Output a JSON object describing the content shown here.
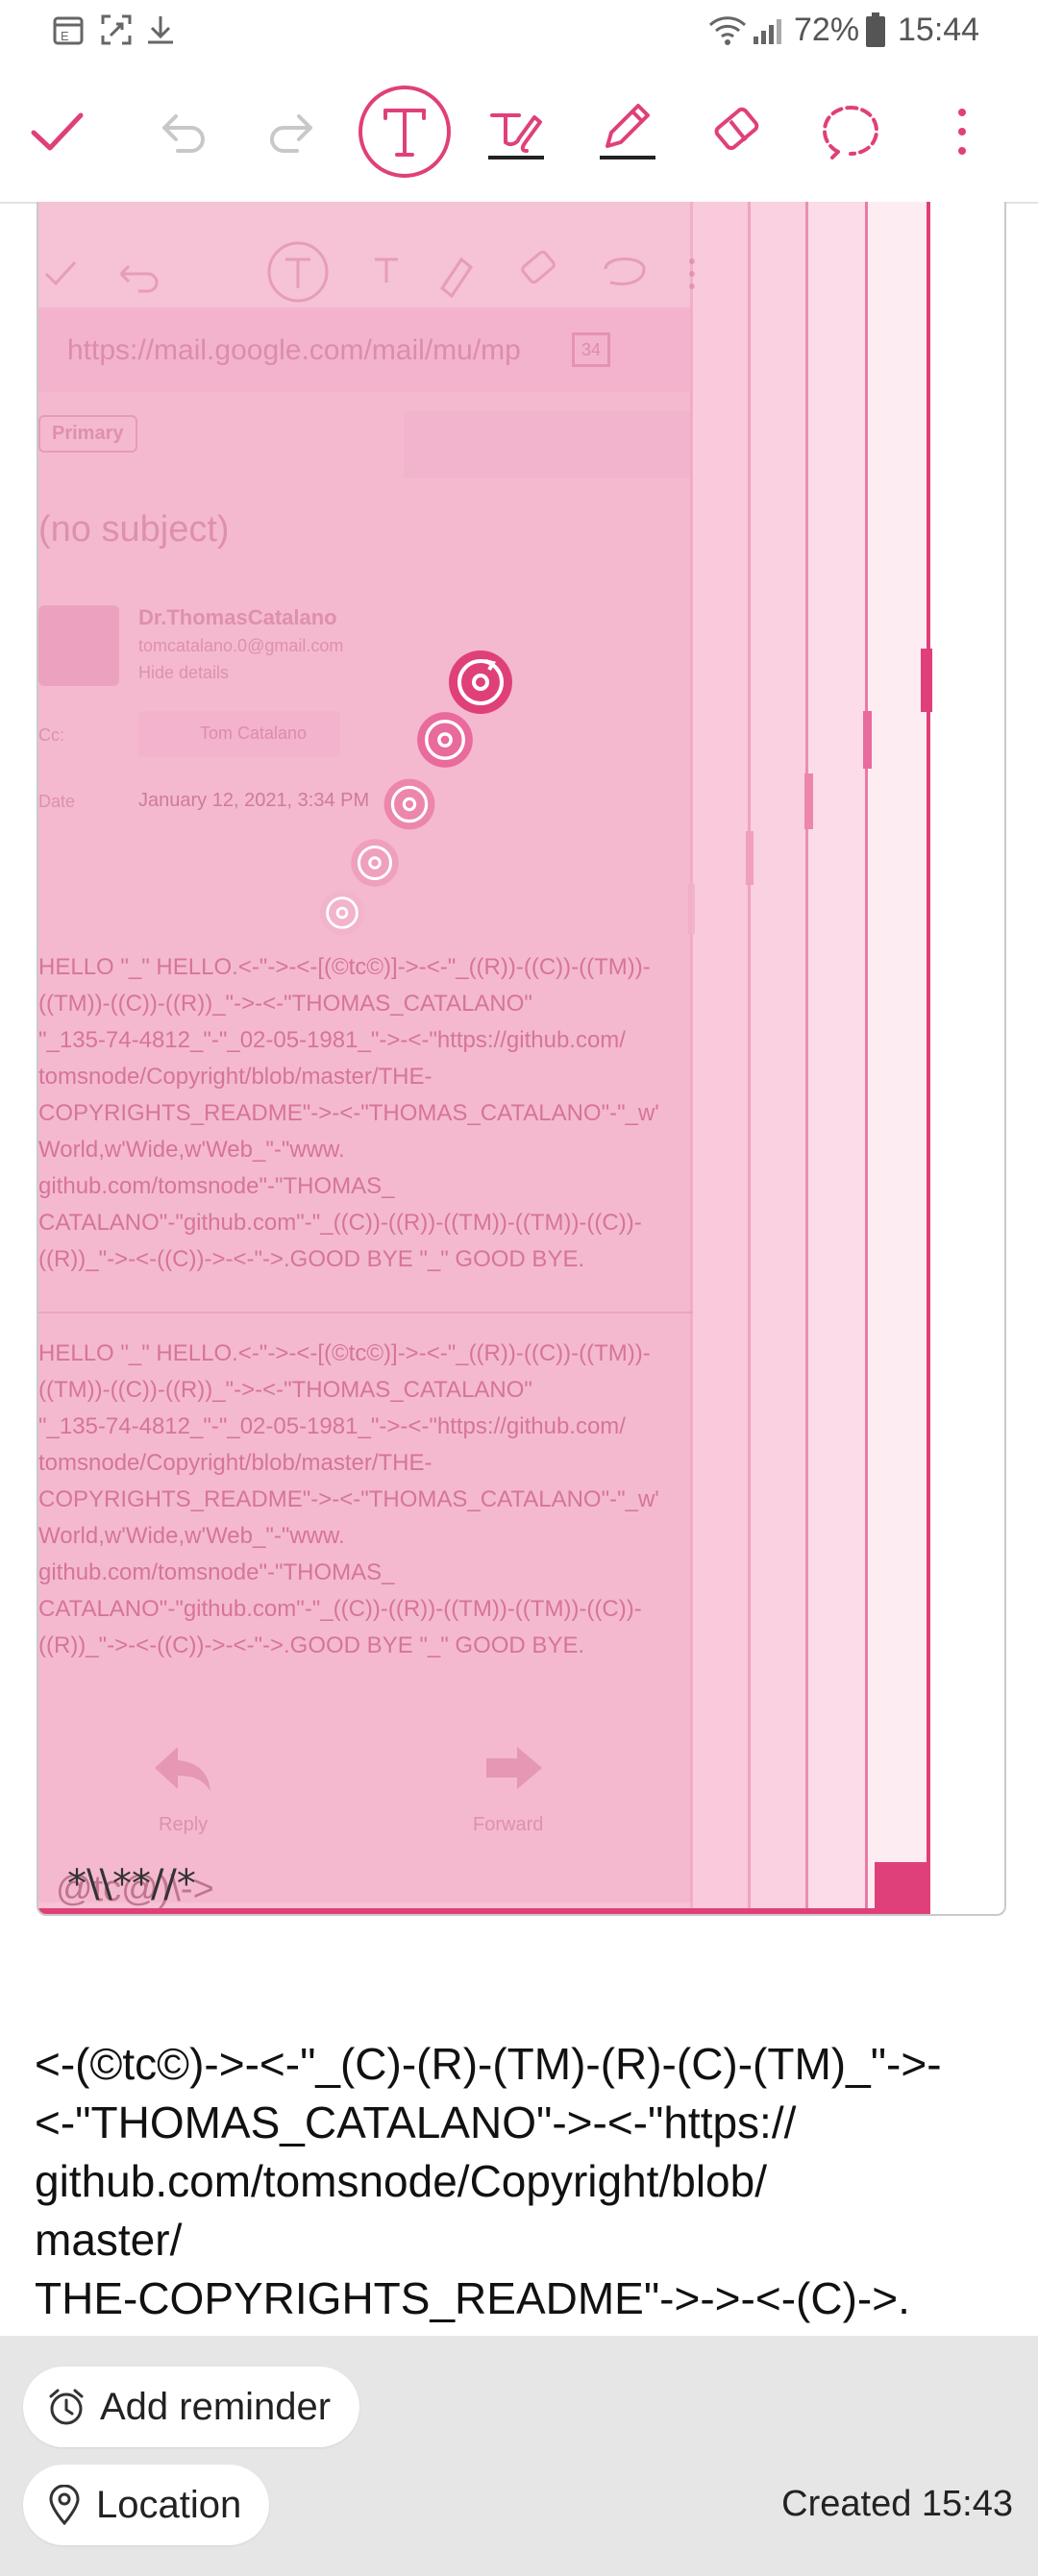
{
  "status_bar": {
    "battery": "72%",
    "time": "15:44",
    "left_icons": [
      "calendar-icon",
      "screenshot-icon",
      "download-icon"
    ],
    "right_icons": [
      "wifi-icon",
      "signal-icon",
      "battery-icon"
    ]
  },
  "toolbar": {
    "icons": [
      "check-icon",
      "undo-icon",
      "redo-icon",
      "text-mode-icon",
      "handwriting-pen-icon",
      "pencil-icon",
      "eraser-icon",
      "lasso-select-icon",
      "more-options-icon"
    ],
    "selected": "text-mode-icon",
    "accent": "#e0407a"
  },
  "canvas": {
    "url_bar": "https://mail.google.com/mail/mu/mp",
    "tab_count": "34",
    "label_primary": "Primary",
    "subject": "(no subject)",
    "sender_name": "Dr.ThomasCatalano",
    "sender_email": "tomcatalano.0@gmail.com",
    "hide_details": "Hide details",
    "cc_label": "Cc:",
    "cc_name": "Tom Catalano",
    "date_label": "Date",
    "date_value": "January 12, 2021, 3:34 PM",
    "body_lines_1": [
      "HELLO \"_\" HELLO.<-\"->-<-[(©tc©)]->-<-\"_((R))-((C))-((TM))-",
      "((TM))-((C))-((R))_\"->-<-\"THOMAS_CATALANO\"",
      "\"_135-74-4812_\"-\"_02-05-1981_\"->-<-\"https://github.com/",
      "tomsnode/Copyright/blob/master/THE-",
      "COPYRIGHTS_README\"->-<-\"THOMAS_CATALANO\"-\"_w'",
      "World,w'Wide,w'Web_\"-\"www.",
      "github.com/tomsnode\"-\"THOMAS_",
      "CATALANO\"-\"github.com\"-\"_((C))-((R))-((TM))-((TM))-((C))-",
      "((R))_\"->-<-((C))->-<-\"->.GOOD BYE \"_\" GOOD BYE."
    ],
    "body_lines_2": [
      "HELLO \"_\" HELLO.<-\"->-<-[(©tc©)]->-<-\"_((R))-((C))-((TM))-",
      "((TM))-((C))-((R))_\"->-<-\"THOMAS_CATALANO\"",
      "\"_135-74-4812_\"-\"_02-05-1981_\"->-<-\"https://github.com/",
      "tomsnode/Copyright/blob/master/THE-",
      "COPYRIGHTS_README\"->-<-\"THOMAS_CATALANO\"-\"_w'",
      "World,w'Wide,w'Web_\"-\"www.",
      "github.com/tomsnode\"-\"THOMAS_",
      "CATALANO\"-\"github.com\"-\"_((C))-((R))-((TM))-((TM))-((C))-",
      "((R))_\"->-<-((C))->-<-\"->.GOOD BYE \"_\" GOOD BYE."
    ],
    "reply_label": "Reply",
    "forward_label": "Forward",
    "overlay_text": "@tc@)\\->",
    "handwriting": "*\\\\**//*"
  },
  "note_text": {
    "lines": [
      "<-(©tc©)->-<-\"_(C)-(R)-(TM)-(R)-(C)-(TM)_\"->-",
      "<-\"THOMAS_CATALANO\"->-<-\"https://",
      "github.com/tomsnode/Copyright/blob/",
      "master/",
      "THE-COPYRIGHTS_README\"->->-<-(C)->."
    ]
  },
  "bottom_bar": {
    "reminder_label": "Add reminder",
    "location_label": "Location",
    "created": "Created 15:43"
  }
}
